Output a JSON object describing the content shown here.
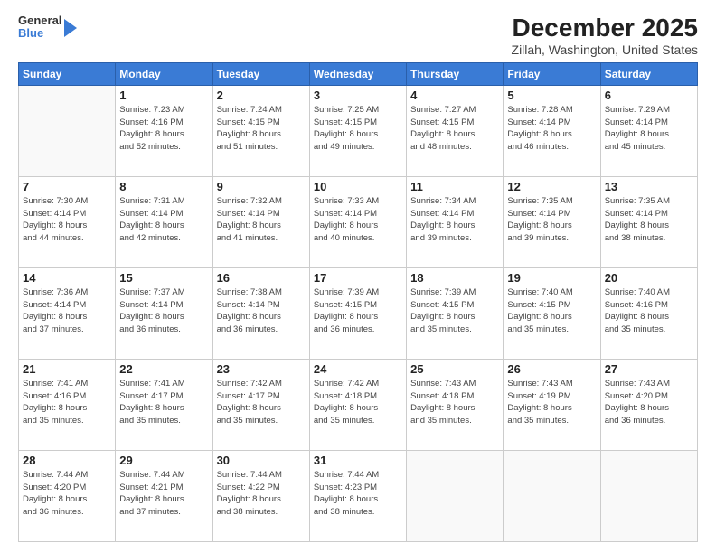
{
  "header": {
    "logo": {
      "general": "General",
      "blue": "Blue"
    },
    "title": "December 2025",
    "location": "Zillah, Washington, United States"
  },
  "weekdays": [
    "Sunday",
    "Monday",
    "Tuesday",
    "Wednesday",
    "Thursday",
    "Friday",
    "Saturday"
  ],
  "weeks": [
    [
      {
        "day": "",
        "info": ""
      },
      {
        "day": "1",
        "info": "Sunrise: 7:23 AM\nSunset: 4:16 PM\nDaylight: 8 hours\nand 52 minutes."
      },
      {
        "day": "2",
        "info": "Sunrise: 7:24 AM\nSunset: 4:15 PM\nDaylight: 8 hours\nand 51 minutes."
      },
      {
        "day": "3",
        "info": "Sunrise: 7:25 AM\nSunset: 4:15 PM\nDaylight: 8 hours\nand 49 minutes."
      },
      {
        "day": "4",
        "info": "Sunrise: 7:27 AM\nSunset: 4:15 PM\nDaylight: 8 hours\nand 48 minutes."
      },
      {
        "day": "5",
        "info": "Sunrise: 7:28 AM\nSunset: 4:14 PM\nDaylight: 8 hours\nand 46 minutes."
      },
      {
        "day": "6",
        "info": "Sunrise: 7:29 AM\nSunset: 4:14 PM\nDaylight: 8 hours\nand 45 minutes."
      }
    ],
    [
      {
        "day": "7",
        "info": "Sunrise: 7:30 AM\nSunset: 4:14 PM\nDaylight: 8 hours\nand 44 minutes."
      },
      {
        "day": "8",
        "info": "Sunrise: 7:31 AM\nSunset: 4:14 PM\nDaylight: 8 hours\nand 42 minutes."
      },
      {
        "day": "9",
        "info": "Sunrise: 7:32 AM\nSunset: 4:14 PM\nDaylight: 8 hours\nand 41 minutes."
      },
      {
        "day": "10",
        "info": "Sunrise: 7:33 AM\nSunset: 4:14 PM\nDaylight: 8 hours\nand 40 minutes."
      },
      {
        "day": "11",
        "info": "Sunrise: 7:34 AM\nSunset: 4:14 PM\nDaylight: 8 hours\nand 39 minutes."
      },
      {
        "day": "12",
        "info": "Sunrise: 7:35 AM\nSunset: 4:14 PM\nDaylight: 8 hours\nand 39 minutes."
      },
      {
        "day": "13",
        "info": "Sunrise: 7:35 AM\nSunset: 4:14 PM\nDaylight: 8 hours\nand 38 minutes."
      }
    ],
    [
      {
        "day": "14",
        "info": "Sunrise: 7:36 AM\nSunset: 4:14 PM\nDaylight: 8 hours\nand 37 minutes."
      },
      {
        "day": "15",
        "info": "Sunrise: 7:37 AM\nSunset: 4:14 PM\nDaylight: 8 hours\nand 36 minutes."
      },
      {
        "day": "16",
        "info": "Sunrise: 7:38 AM\nSunset: 4:14 PM\nDaylight: 8 hours\nand 36 minutes."
      },
      {
        "day": "17",
        "info": "Sunrise: 7:39 AM\nSunset: 4:15 PM\nDaylight: 8 hours\nand 36 minutes."
      },
      {
        "day": "18",
        "info": "Sunrise: 7:39 AM\nSunset: 4:15 PM\nDaylight: 8 hours\nand 35 minutes."
      },
      {
        "day": "19",
        "info": "Sunrise: 7:40 AM\nSunset: 4:15 PM\nDaylight: 8 hours\nand 35 minutes."
      },
      {
        "day": "20",
        "info": "Sunrise: 7:40 AM\nSunset: 4:16 PM\nDaylight: 8 hours\nand 35 minutes."
      }
    ],
    [
      {
        "day": "21",
        "info": "Sunrise: 7:41 AM\nSunset: 4:16 PM\nDaylight: 8 hours\nand 35 minutes."
      },
      {
        "day": "22",
        "info": "Sunrise: 7:41 AM\nSunset: 4:17 PM\nDaylight: 8 hours\nand 35 minutes."
      },
      {
        "day": "23",
        "info": "Sunrise: 7:42 AM\nSunset: 4:17 PM\nDaylight: 8 hours\nand 35 minutes."
      },
      {
        "day": "24",
        "info": "Sunrise: 7:42 AM\nSunset: 4:18 PM\nDaylight: 8 hours\nand 35 minutes."
      },
      {
        "day": "25",
        "info": "Sunrise: 7:43 AM\nSunset: 4:18 PM\nDaylight: 8 hours\nand 35 minutes."
      },
      {
        "day": "26",
        "info": "Sunrise: 7:43 AM\nSunset: 4:19 PM\nDaylight: 8 hours\nand 35 minutes."
      },
      {
        "day": "27",
        "info": "Sunrise: 7:43 AM\nSunset: 4:20 PM\nDaylight: 8 hours\nand 36 minutes."
      }
    ],
    [
      {
        "day": "28",
        "info": "Sunrise: 7:44 AM\nSunset: 4:20 PM\nDaylight: 8 hours\nand 36 minutes."
      },
      {
        "day": "29",
        "info": "Sunrise: 7:44 AM\nSunset: 4:21 PM\nDaylight: 8 hours\nand 37 minutes."
      },
      {
        "day": "30",
        "info": "Sunrise: 7:44 AM\nSunset: 4:22 PM\nDaylight: 8 hours\nand 38 minutes."
      },
      {
        "day": "31",
        "info": "Sunrise: 7:44 AM\nSunset: 4:23 PM\nDaylight: 8 hours\nand 38 minutes."
      },
      {
        "day": "",
        "info": ""
      },
      {
        "day": "",
        "info": ""
      },
      {
        "day": "",
        "info": ""
      }
    ]
  ]
}
